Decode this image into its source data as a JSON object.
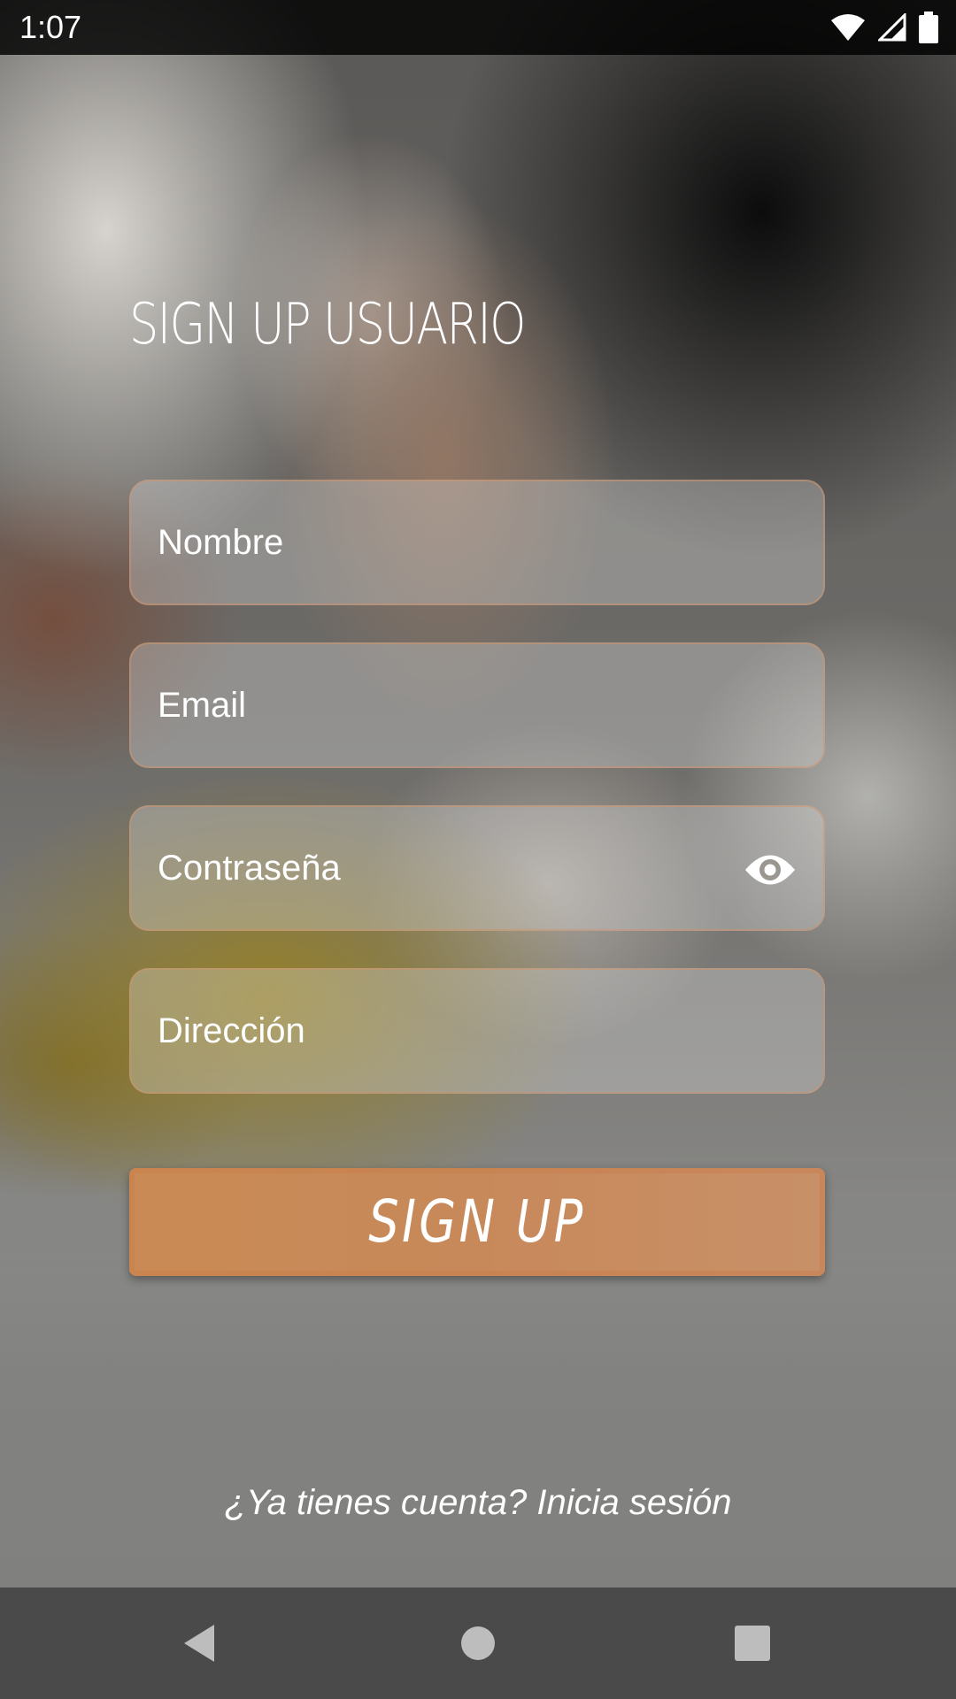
{
  "status_bar": {
    "time": "1:07",
    "icons": [
      "wifi-icon",
      "cell-signal-icon",
      "battery-icon"
    ]
  },
  "title": "SIGN UP USUARIO",
  "form": {
    "nombre": {
      "placeholder": "Nombre",
      "value": ""
    },
    "email": {
      "placeholder": "Email",
      "value": ""
    },
    "password": {
      "placeholder": "Contraseña",
      "value": "",
      "toggle_icon": "eye-icon"
    },
    "direccion": {
      "placeholder": "Dirección",
      "value": ""
    },
    "submit_label": "SIGN UP"
  },
  "login_prompt": "¿Ya tienes cuenta? Inicia sesión",
  "nav_bar": {
    "icons": [
      "back-icon",
      "home-icon",
      "recents-icon"
    ]
  },
  "colors": {
    "button": "#c98a55",
    "field_border": "#cd966e",
    "text": "#ffffff",
    "nav_bar": "#4a4a4a"
  }
}
